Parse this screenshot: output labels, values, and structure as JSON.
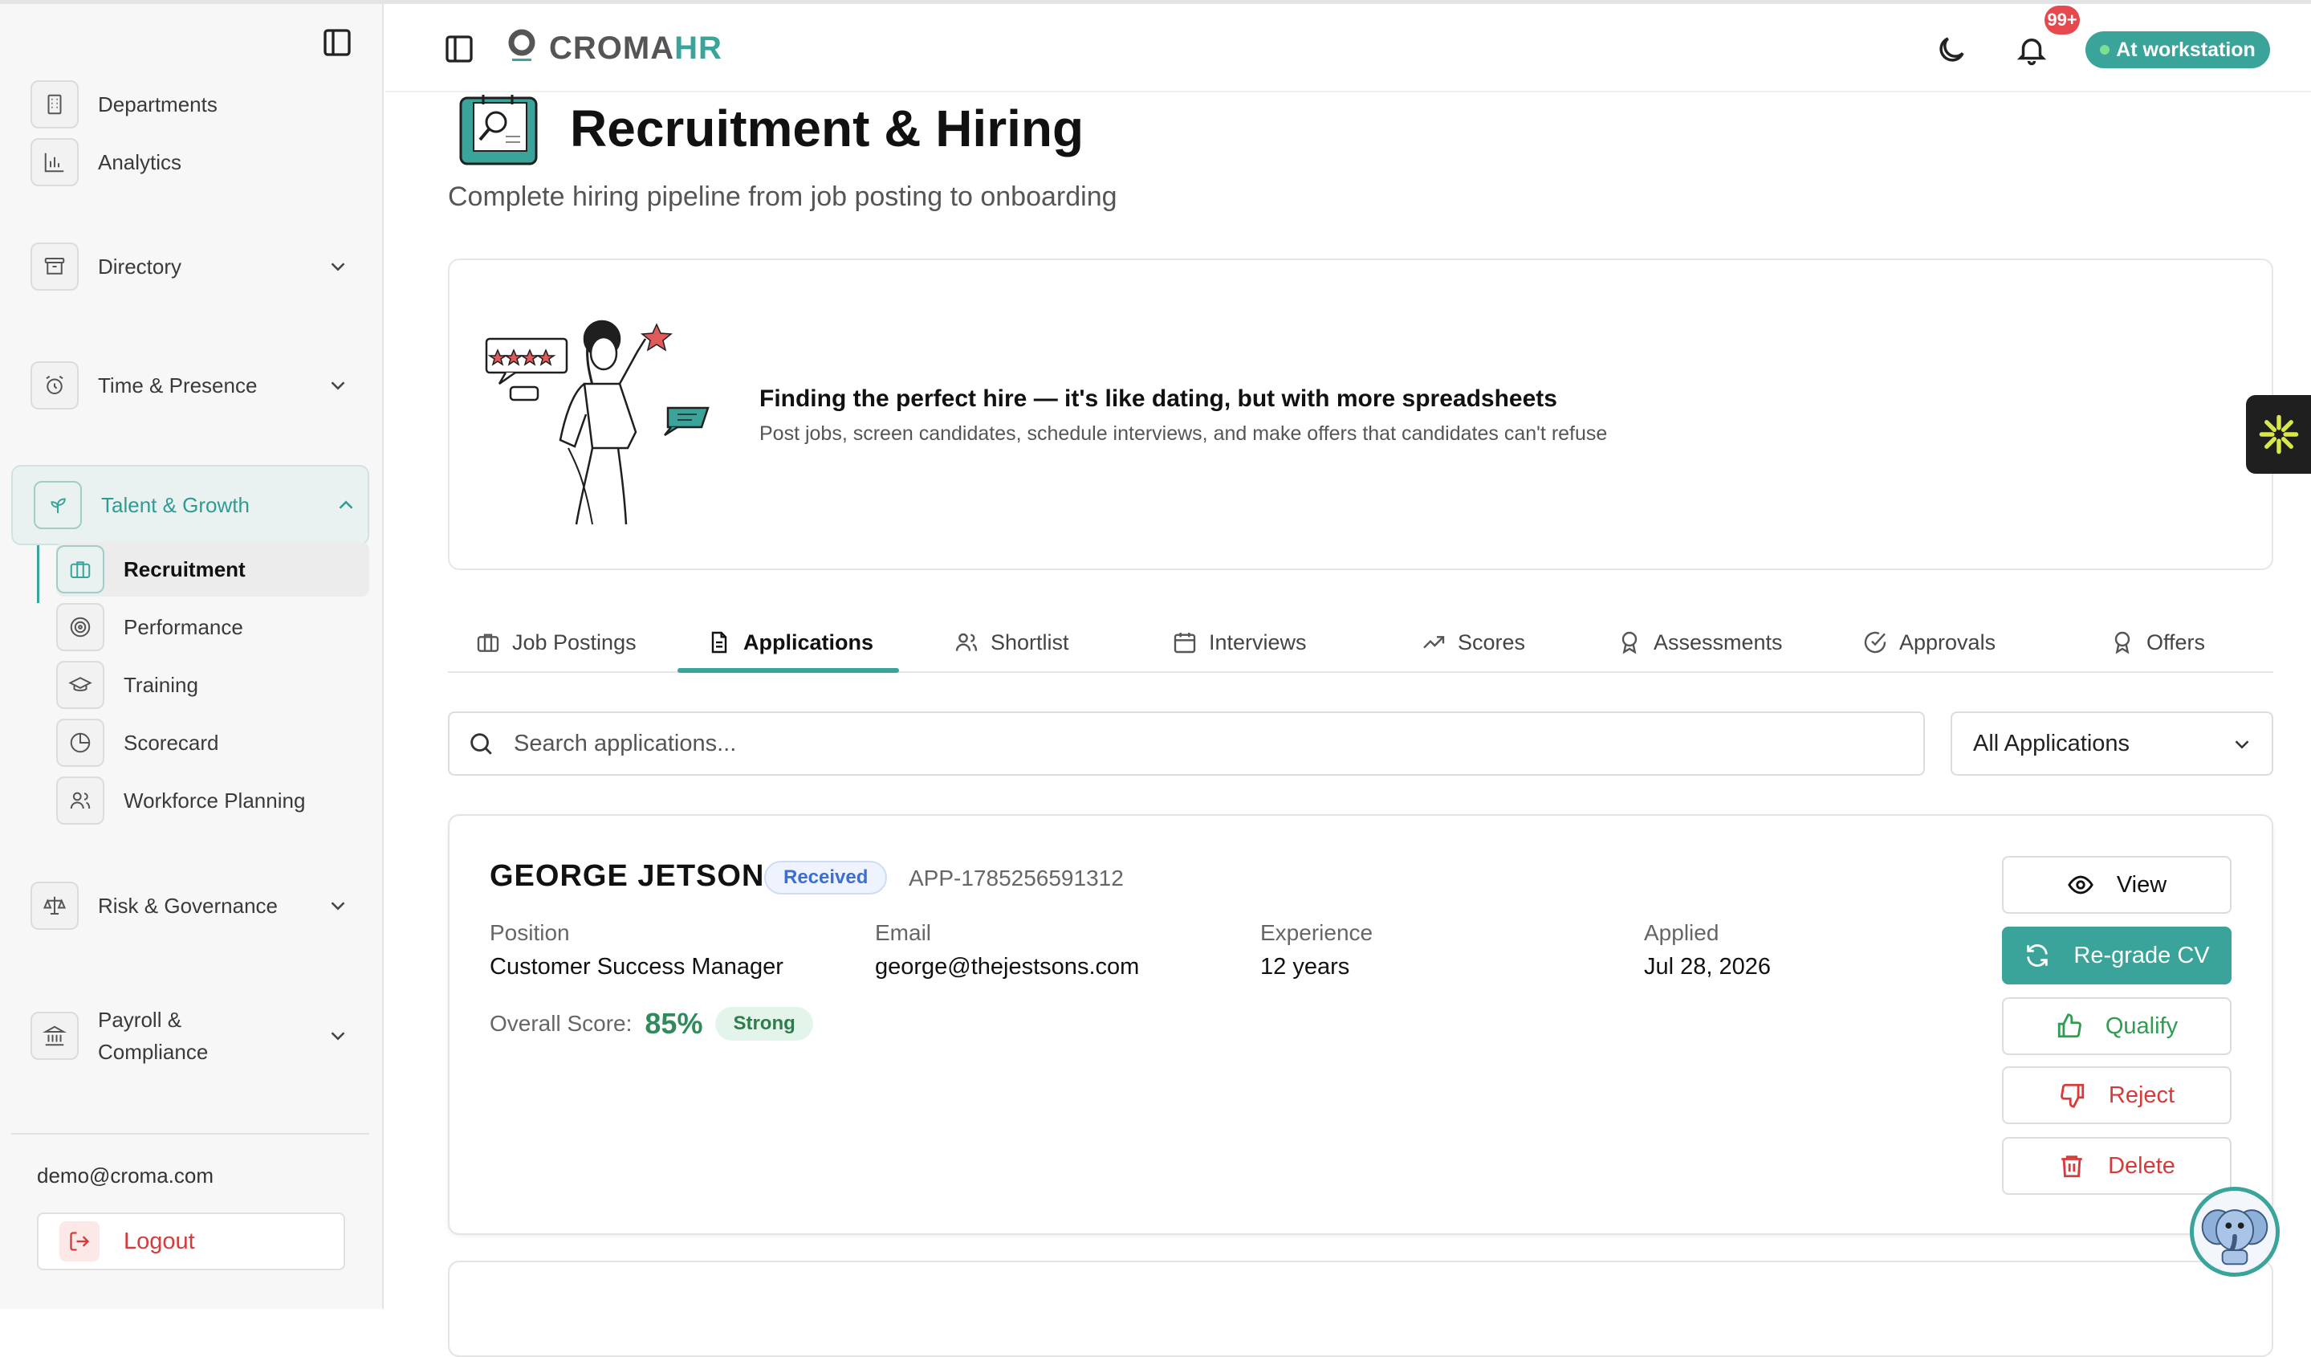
{
  "sidebar": {
    "items": [
      {
        "label": "Departments",
        "icon": "building-icon"
      },
      {
        "label": "Analytics",
        "icon": "bar-chart-icon"
      },
      {
        "label": "Directory",
        "icon": "archive-icon"
      },
      {
        "label": "Time & Presence",
        "icon": "alarm-clock-icon"
      },
      {
        "label": "Talent & Growth",
        "icon": "sprout-icon"
      },
      {
        "label": "Risk & Governance",
        "icon": "scale-icon"
      },
      {
        "label": "Payroll &",
        "label2": "Compliance",
        "icon": "bank-icon"
      }
    ],
    "subitems": [
      {
        "label": "Recruitment",
        "icon": "briefcase-icon"
      },
      {
        "label": "Performance",
        "icon": "target-icon"
      },
      {
        "label": "Training",
        "icon": "graduation-cap-icon"
      },
      {
        "label": "Scorecard",
        "icon": "pie-chart-icon"
      },
      {
        "label": "Workforce Planning",
        "icon": "users-icon"
      }
    ],
    "email": "demo@croma.com",
    "logout": "Logout"
  },
  "header": {
    "logo_primary": "CROMA",
    "logo_accent": "HR",
    "notification_count": "99+",
    "status": "At workstation"
  },
  "page": {
    "title": "Recruitment & Hiring",
    "subtitle": "Complete hiring pipeline from job posting to onboarding"
  },
  "hero": {
    "title": "Finding the perfect hire — it's like dating, but with more spreadsheets",
    "description": "Post jobs, screen candidates, schedule interviews, and make offers that candidates can't refuse"
  },
  "tabs": [
    {
      "label": "Job Postings",
      "icon": "briefcase-icon"
    },
    {
      "label": "Applications",
      "icon": "file-text-icon",
      "active": true
    },
    {
      "label": "Shortlist",
      "icon": "users-icon"
    },
    {
      "label": "Interviews",
      "icon": "calendar-icon"
    },
    {
      "label": "Scores",
      "icon": "trending-up-icon"
    },
    {
      "label": "Assessments",
      "icon": "award-icon"
    },
    {
      "label": "Approvals",
      "icon": "check-circle-icon"
    },
    {
      "label": "Offers",
      "icon": "award-icon"
    }
  ],
  "search": {
    "placeholder": "Search applications..."
  },
  "filter": {
    "selected": "All Applications"
  },
  "application": {
    "name": "GEORGE JETSON",
    "status": "Received",
    "id": "APP-1785256591312",
    "fields": [
      {
        "label": "Position",
        "value": "Customer Success Manager"
      },
      {
        "label": "Email",
        "value": "george@thejestsons.com"
      },
      {
        "label": "Experience",
        "value": "12 years"
      },
      {
        "label": "Applied",
        "value": "Jul 28, 2026"
      }
    ],
    "score_label": "Overall Score:",
    "score_value": "85%",
    "score_badge": "Strong",
    "actions": {
      "view": "View",
      "regrade": "Re-grade CV",
      "qualify": "Qualify",
      "reject": "Reject",
      "delete": "Delete"
    }
  },
  "colors": {
    "accent": "#3aa39a",
    "danger": "#d63b3b",
    "success": "#2f9c50",
    "info": "#3c6fd1"
  }
}
